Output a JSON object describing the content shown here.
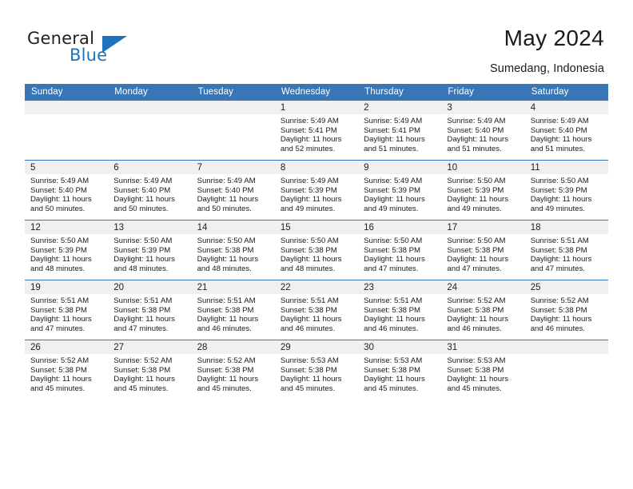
{
  "brand": {
    "name_part1": "General",
    "name_part2": "Blue",
    "accent_color": "#1f72bd"
  },
  "header": {
    "title": "May 2024",
    "subtitle": "Sumedang, Indonesia",
    "header_bg_color": "#3876b6"
  },
  "weekday_headers": [
    "Sunday",
    "Monday",
    "Tuesday",
    "Wednesday",
    "Thursday",
    "Friday",
    "Saturday"
  ],
  "labels": {
    "sunrise_prefix": "Sunrise:",
    "sunset_prefix": "Sunset:",
    "daylight_prefix": "Daylight:"
  },
  "weeks": [
    [
      {
        "day": "",
        "sunrise": "",
        "sunset": "",
        "daylight_line1": "",
        "daylight_line2": ""
      },
      {
        "day": "",
        "sunrise": "",
        "sunset": "",
        "daylight_line1": "",
        "daylight_line2": ""
      },
      {
        "day": "",
        "sunrise": "",
        "sunset": "",
        "daylight_line1": "",
        "daylight_line2": ""
      },
      {
        "day": "1",
        "sunrise": "Sunrise: 5:49 AM",
        "sunset": "Sunset: 5:41 PM",
        "daylight_line1": "Daylight: 11 hours",
        "daylight_line2": "and 52 minutes."
      },
      {
        "day": "2",
        "sunrise": "Sunrise: 5:49 AM",
        "sunset": "Sunset: 5:41 PM",
        "daylight_line1": "Daylight: 11 hours",
        "daylight_line2": "and 51 minutes."
      },
      {
        "day": "3",
        "sunrise": "Sunrise: 5:49 AM",
        "sunset": "Sunset: 5:40 PM",
        "daylight_line1": "Daylight: 11 hours",
        "daylight_line2": "and 51 minutes."
      },
      {
        "day": "4",
        "sunrise": "Sunrise: 5:49 AM",
        "sunset": "Sunset: 5:40 PM",
        "daylight_line1": "Daylight: 11 hours",
        "daylight_line2": "and 51 minutes."
      }
    ],
    [
      {
        "day": "5",
        "sunrise": "Sunrise: 5:49 AM",
        "sunset": "Sunset: 5:40 PM",
        "daylight_line1": "Daylight: 11 hours",
        "daylight_line2": "and 50 minutes."
      },
      {
        "day": "6",
        "sunrise": "Sunrise: 5:49 AM",
        "sunset": "Sunset: 5:40 PM",
        "daylight_line1": "Daylight: 11 hours",
        "daylight_line2": "and 50 minutes."
      },
      {
        "day": "7",
        "sunrise": "Sunrise: 5:49 AM",
        "sunset": "Sunset: 5:40 PM",
        "daylight_line1": "Daylight: 11 hours",
        "daylight_line2": "and 50 minutes."
      },
      {
        "day": "8",
        "sunrise": "Sunrise: 5:49 AM",
        "sunset": "Sunset: 5:39 PM",
        "daylight_line1": "Daylight: 11 hours",
        "daylight_line2": "and 49 minutes."
      },
      {
        "day": "9",
        "sunrise": "Sunrise: 5:49 AM",
        "sunset": "Sunset: 5:39 PM",
        "daylight_line1": "Daylight: 11 hours",
        "daylight_line2": "and 49 minutes."
      },
      {
        "day": "10",
        "sunrise": "Sunrise: 5:50 AM",
        "sunset": "Sunset: 5:39 PM",
        "daylight_line1": "Daylight: 11 hours",
        "daylight_line2": "and 49 minutes."
      },
      {
        "day": "11",
        "sunrise": "Sunrise: 5:50 AM",
        "sunset": "Sunset: 5:39 PM",
        "daylight_line1": "Daylight: 11 hours",
        "daylight_line2": "and 49 minutes."
      }
    ],
    [
      {
        "day": "12",
        "sunrise": "Sunrise: 5:50 AM",
        "sunset": "Sunset: 5:39 PM",
        "daylight_line1": "Daylight: 11 hours",
        "daylight_line2": "and 48 minutes."
      },
      {
        "day": "13",
        "sunrise": "Sunrise: 5:50 AM",
        "sunset": "Sunset: 5:39 PM",
        "daylight_line1": "Daylight: 11 hours",
        "daylight_line2": "and 48 minutes."
      },
      {
        "day": "14",
        "sunrise": "Sunrise: 5:50 AM",
        "sunset": "Sunset: 5:38 PM",
        "daylight_line1": "Daylight: 11 hours",
        "daylight_line2": "and 48 minutes."
      },
      {
        "day": "15",
        "sunrise": "Sunrise: 5:50 AM",
        "sunset": "Sunset: 5:38 PM",
        "daylight_line1": "Daylight: 11 hours",
        "daylight_line2": "and 48 minutes."
      },
      {
        "day": "16",
        "sunrise": "Sunrise: 5:50 AM",
        "sunset": "Sunset: 5:38 PM",
        "daylight_line1": "Daylight: 11 hours",
        "daylight_line2": "and 47 minutes."
      },
      {
        "day": "17",
        "sunrise": "Sunrise: 5:50 AM",
        "sunset": "Sunset: 5:38 PM",
        "daylight_line1": "Daylight: 11 hours",
        "daylight_line2": "and 47 minutes."
      },
      {
        "day": "18",
        "sunrise": "Sunrise: 5:51 AM",
        "sunset": "Sunset: 5:38 PM",
        "daylight_line1": "Daylight: 11 hours",
        "daylight_line2": "and 47 minutes."
      }
    ],
    [
      {
        "day": "19",
        "sunrise": "Sunrise: 5:51 AM",
        "sunset": "Sunset: 5:38 PM",
        "daylight_line1": "Daylight: 11 hours",
        "daylight_line2": "and 47 minutes."
      },
      {
        "day": "20",
        "sunrise": "Sunrise: 5:51 AM",
        "sunset": "Sunset: 5:38 PM",
        "daylight_line1": "Daylight: 11 hours",
        "daylight_line2": "and 47 minutes."
      },
      {
        "day": "21",
        "sunrise": "Sunrise: 5:51 AM",
        "sunset": "Sunset: 5:38 PM",
        "daylight_line1": "Daylight: 11 hours",
        "daylight_line2": "and 46 minutes."
      },
      {
        "day": "22",
        "sunrise": "Sunrise: 5:51 AM",
        "sunset": "Sunset: 5:38 PM",
        "daylight_line1": "Daylight: 11 hours",
        "daylight_line2": "and 46 minutes."
      },
      {
        "day": "23",
        "sunrise": "Sunrise: 5:51 AM",
        "sunset": "Sunset: 5:38 PM",
        "daylight_line1": "Daylight: 11 hours",
        "daylight_line2": "and 46 minutes."
      },
      {
        "day": "24",
        "sunrise": "Sunrise: 5:52 AM",
        "sunset": "Sunset: 5:38 PM",
        "daylight_line1": "Daylight: 11 hours",
        "daylight_line2": "and 46 minutes."
      },
      {
        "day": "25",
        "sunrise": "Sunrise: 5:52 AM",
        "sunset": "Sunset: 5:38 PM",
        "daylight_line1": "Daylight: 11 hours",
        "daylight_line2": "and 46 minutes."
      }
    ],
    [
      {
        "day": "26",
        "sunrise": "Sunrise: 5:52 AM",
        "sunset": "Sunset: 5:38 PM",
        "daylight_line1": "Daylight: 11 hours",
        "daylight_line2": "and 45 minutes."
      },
      {
        "day": "27",
        "sunrise": "Sunrise: 5:52 AM",
        "sunset": "Sunset: 5:38 PM",
        "daylight_line1": "Daylight: 11 hours",
        "daylight_line2": "and 45 minutes."
      },
      {
        "day": "28",
        "sunrise": "Sunrise: 5:52 AM",
        "sunset": "Sunset: 5:38 PM",
        "daylight_line1": "Daylight: 11 hours",
        "daylight_line2": "and 45 minutes."
      },
      {
        "day": "29",
        "sunrise": "Sunrise: 5:53 AM",
        "sunset": "Sunset: 5:38 PM",
        "daylight_line1": "Daylight: 11 hours",
        "daylight_line2": "and 45 minutes."
      },
      {
        "day": "30",
        "sunrise": "Sunrise: 5:53 AM",
        "sunset": "Sunset: 5:38 PM",
        "daylight_line1": "Daylight: 11 hours",
        "daylight_line2": "and 45 minutes."
      },
      {
        "day": "31",
        "sunrise": "Sunrise: 5:53 AM",
        "sunset": "Sunset: 5:38 PM",
        "daylight_line1": "Daylight: 11 hours",
        "daylight_line2": "and 45 minutes."
      },
      {
        "day": "",
        "sunrise": "",
        "sunset": "",
        "daylight_line1": "",
        "daylight_line2": ""
      }
    ]
  ]
}
